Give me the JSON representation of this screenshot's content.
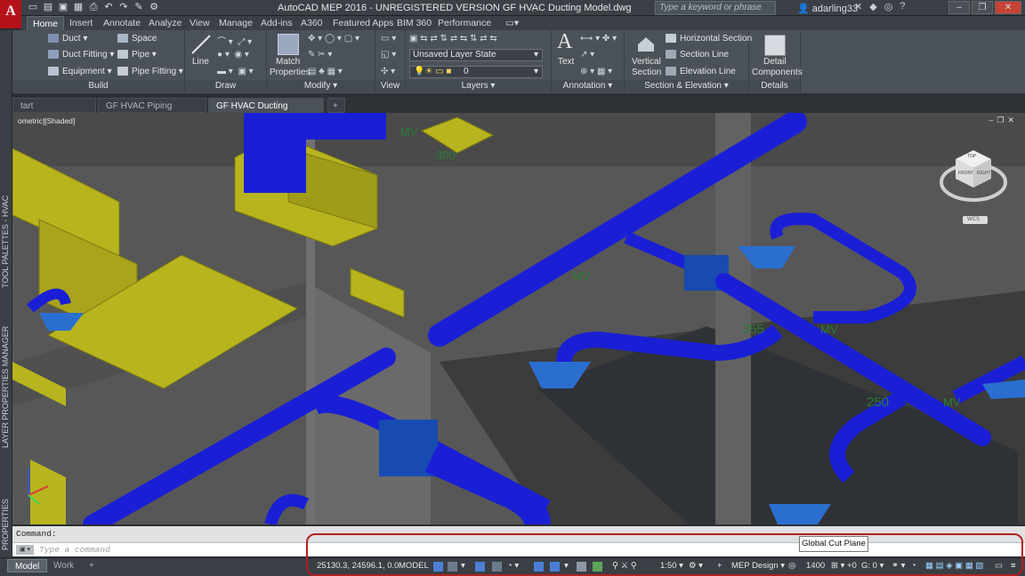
{
  "app": {
    "logo_letter": "A",
    "title": "AutoCAD MEP 2016 - UNREGISTERED VERSION   GF HVAC Ducting Model.dwg",
    "search_placeholder": "Type a keyword or phrase",
    "user": "adarling33"
  },
  "ribbon_tabs": [
    "Home",
    "Insert",
    "Annotate",
    "Analyze",
    "View",
    "Manage",
    "Add-ins",
    "A360",
    "Featured Apps",
    "BIM 360",
    "Performance"
  ],
  "ribbon": {
    "build": {
      "title": "Build",
      "items": [
        "Duct",
        "Space",
        "Duct Fitting",
        "Pipe",
        "Equipment",
        "Pipe Fitting"
      ]
    },
    "draw": {
      "title": "Draw",
      "line_label": "Line"
    },
    "modify": {
      "title": "Modify",
      "match_label": "Match",
      "properties_label": "Properties"
    },
    "view": {
      "title": "View"
    },
    "layers": {
      "title": "Layers",
      "layer_state": "Unsaved Layer State",
      "layer_name": "0"
    },
    "annotation": {
      "title": "Annotation",
      "text_label": "Text"
    },
    "section": {
      "title": "Section & Elevation",
      "vertical_label": "Vertical",
      "section_label": "Section",
      "items": [
        "Horizontal Section",
        "Section Line",
        "Elevation Line"
      ]
    },
    "details": {
      "title": "Details",
      "detail_label": "Detail",
      "components_label": "Components"
    }
  },
  "doc_tabs": [
    "tart",
    "GF HVAC Piping Model*",
    "GF HVAC Ducting Model*"
  ],
  "side_labels": {
    "tool_palettes": "TOOL PALETTES - HVAC",
    "layer_manager": "LAYER PROPERTIES MANAGER",
    "properties": "PROPERTIES"
  },
  "viewport": {
    "label": "ometric][Shaded]",
    "viewcube_top": "TOP",
    "viewcube_front": "FRONT",
    "viewcube_right": "RIGHT",
    "wcs": "WCS",
    "tags": [
      "MV",
      "300",
      "MV",
      "MV",
      "355",
      "MV",
      "250",
      "MV"
    ]
  },
  "command": {
    "history": "Command:",
    "placeholder": "Type a command"
  },
  "layout_tabs": [
    "Model",
    "Work"
  ],
  "status": {
    "coords": "25130.3, 24596.1, 0.0",
    "space": "MODEL",
    "scale": "1:50",
    "workspace": "MEP Design",
    "elevation": "1400",
    "offset": "+0",
    "g_value": "G: 0",
    "tooltip": "Global Cut Plane"
  },
  "colors": {
    "duct_blue": "#1a1fd6",
    "duct_yellow": "#b8b41e",
    "highlight": "#b1201e",
    "ribbon": "#4b5158"
  }
}
